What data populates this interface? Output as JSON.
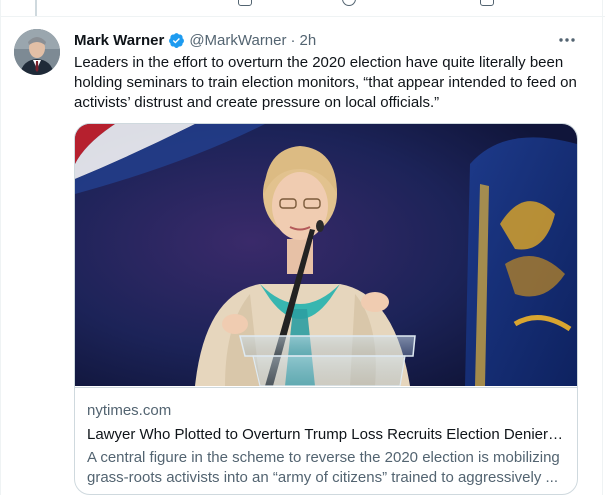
{
  "tweet": {
    "author_name": "Mark Warner",
    "handle": "@MarkWarner",
    "separator": "·",
    "time": "2h",
    "text": "Leaders in the effort to overturn the 2020 election have quite literally been holding seminars to train election monitors, “that appear intended to feed on activists’ distrust and create pressure on local officials.”"
  },
  "card": {
    "domain": "nytimes.com",
    "title": "Lawyer Who Plotted to Overturn Trump Loss Recruits Election Deniers...",
    "description": "A central figure in the scheme to reverse the 2020 election is mobilizing grass-roots activists into an “army of citizens” trained to aggressively ..."
  },
  "icons": {
    "verified": "verified-badge-icon",
    "more": "more-options-icon"
  },
  "colors": {
    "accent": "#1d9bf0",
    "text_primary": "#0f1419",
    "text_secondary": "#536471",
    "border": "#cfd9de"
  }
}
